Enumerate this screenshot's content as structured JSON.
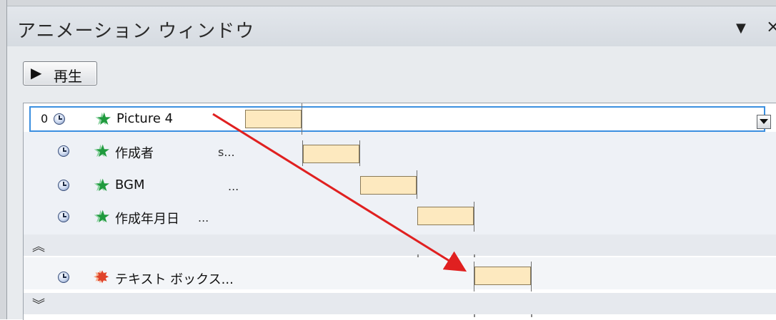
{
  "pane": {
    "title": "アニメーション ウィンドウ",
    "dropdown_icon": "▼",
    "close_icon": "×"
  },
  "toolbar": {
    "play_label": "再生",
    "play_icon": "▶"
  },
  "rows": [
    {
      "number": "0",
      "name": "Picture 4",
      "extra": "",
      "effect": "entrance-green"
    },
    {
      "number": "",
      "name": "作成者",
      "extra": "s...",
      "effect": "entrance-green"
    },
    {
      "number": "",
      "name": "BGM",
      "extra": "...",
      "effect": "entrance-green"
    },
    {
      "number": "",
      "name": "作成年月日",
      "extra": "...",
      "effect": "entrance-green"
    },
    {
      "number": "",
      "name": "テキスト ボックス...",
      "extra": "",
      "effect": "emphasis-red"
    }
  ],
  "separators": {
    "collapse_icon": "︽",
    "expand_icon": "︾"
  },
  "colors": {
    "arrow": "#e02020",
    "selection": "#3b8fe0",
    "bar_fill": "#fde9bf"
  }
}
